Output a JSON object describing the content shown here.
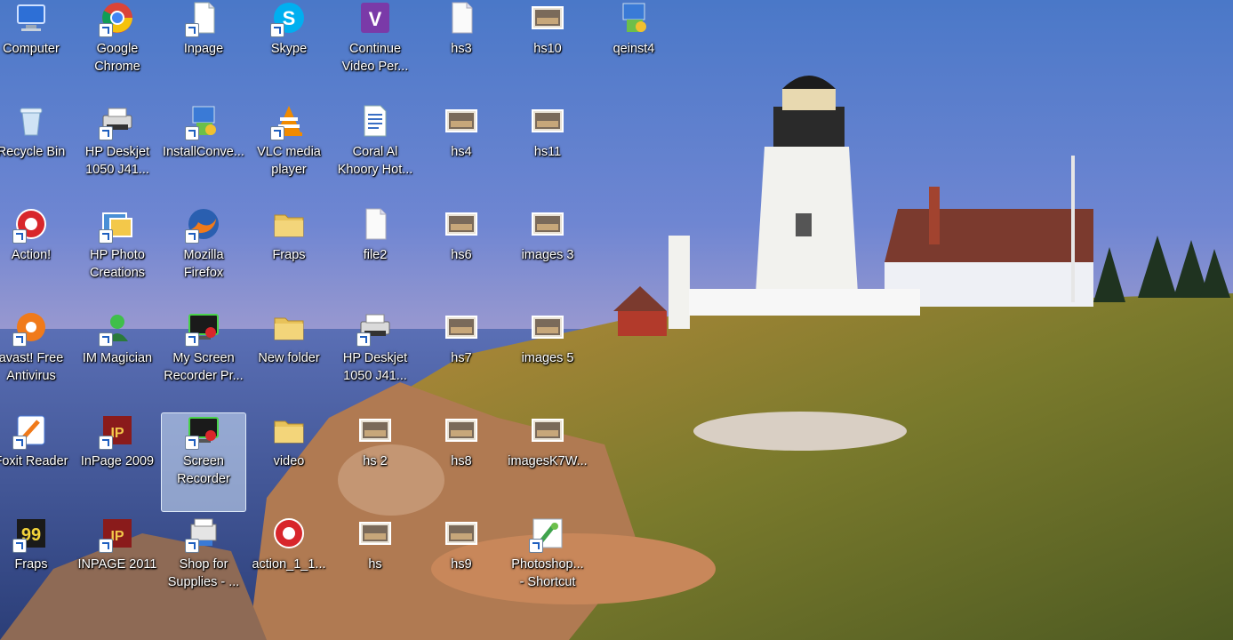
{
  "desktop": {
    "icons": [
      {
        "label": "Computer",
        "icon": "computer-icon",
        "shortcut": false,
        "selected": false
      },
      {
        "label": "Google\nChrome",
        "icon": "chrome-icon",
        "shortcut": true,
        "selected": false
      },
      {
        "label": "Inpage",
        "icon": "document-icon",
        "shortcut": true,
        "selected": false
      },
      {
        "label": "Skype",
        "icon": "skype-icon",
        "shortcut": true,
        "selected": false
      },
      {
        "label": "Continue\nVideo Per...",
        "icon": "video-editor-icon",
        "shortcut": false,
        "selected": false
      },
      {
        "label": "hs3",
        "icon": "blank-file-icon",
        "shortcut": false,
        "selected": false
      },
      {
        "label": "hs10",
        "icon": "image-thumbnail-icon",
        "shortcut": false,
        "selected": false
      },
      {
        "label": "qeinst4",
        "icon": "installer-icon",
        "shortcut": false,
        "selected": false
      },
      {
        "label": "Recycle Bin",
        "icon": "recycle-bin-icon",
        "shortcut": false,
        "selected": false
      },
      {
        "label": "HP Deskjet\n1050 J41...",
        "icon": "printer-icon",
        "shortcut": true,
        "selected": false
      },
      {
        "label": "InstallConve...",
        "icon": "installer-icon",
        "shortcut": true,
        "selected": false
      },
      {
        "label": "VLC media\nplayer",
        "icon": "vlc-icon",
        "shortcut": true,
        "selected": false
      },
      {
        "label": "Coral Al\nKhoory Hot...",
        "icon": "word-document-icon",
        "shortcut": false,
        "selected": false
      },
      {
        "label": "hs4",
        "icon": "image-thumbnail-icon",
        "shortcut": false,
        "selected": false
      },
      {
        "label": "hs11",
        "icon": "image-thumbnail-icon",
        "shortcut": false,
        "selected": false
      },
      {
        "label": "Action!",
        "icon": "action-recorder-icon",
        "shortcut": true,
        "selected": false
      },
      {
        "label": "HP Photo\nCreations",
        "icon": "photo-creations-icon",
        "shortcut": true,
        "selected": false
      },
      {
        "label": "Mozilla\nFirefox",
        "icon": "firefox-icon",
        "shortcut": true,
        "selected": false
      },
      {
        "label": "Fraps",
        "icon": "folder-icon",
        "shortcut": false,
        "selected": false
      },
      {
        "label": "file2",
        "icon": "blank-file-icon",
        "shortcut": false,
        "selected": false
      },
      {
        "label": "hs6",
        "icon": "image-thumbnail-icon",
        "shortcut": false,
        "selected": false
      },
      {
        "label": "images 3",
        "icon": "image-thumbnail-icon",
        "shortcut": false,
        "selected": false
      },
      {
        "label": "avast! Free\nAntivirus",
        "icon": "avast-icon",
        "shortcut": true,
        "selected": false
      },
      {
        "label": "IM Magician",
        "icon": "im-magician-icon",
        "shortcut": true,
        "selected": false
      },
      {
        "label": "My Screen\nRecorder Pr...",
        "icon": "screen-recorder-icon",
        "shortcut": true,
        "selected": false
      },
      {
        "label": "New folder",
        "icon": "folder-icon",
        "shortcut": false,
        "selected": false
      },
      {
        "label": "HP Deskjet\n1050 J41...",
        "icon": "printer-icon",
        "shortcut": true,
        "selected": false
      },
      {
        "label": "hs7",
        "icon": "image-thumbnail-icon",
        "shortcut": false,
        "selected": false
      },
      {
        "label": "images 5",
        "icon": "image-thumbnail-icon",
        "shortcut": false,
        "selected": false
      },
      {
        "label": "Foxit Reader",
        "icon": "foxit-reader-icon",
        "shortcut": true,
        "selected": false
      },
      {
        "label": "InPage 2009",
        "icon": "inpage-icon",
        "shortcut": true,
        "selected": false
      },
      {
        "label": "Screen\nRecorder",
        "icon": "screen-recorder-icon",
        "shortcut": true,
        "selected": true
      },
      {
        "label": "video",
        "icon": "folder-icon",
        "shortcut": false,
        "selected": false
      },
      {
        "label": "hs 2",
        "icon": "image-thumbnail-icon",
        "shortcut": false,
        "selected": false
      },
      {
        "label": "hs8",
        "icon": "image-thumbnail-icon",
        "shortcut": false,
        "selected": false
      },
      {
        "label": "imagesK7W...",
        "icon": "image-thumbnail-icon",
        "shortcut": false,
        "selected": false
      },
      {
        "label": "Fraps",
        "icon": "fraps-icon",
        "shortcut": true,
        "selected": false
      },
      {
        "label": "INPAGE 2011",
        "icon": "inpage-icon",
        "shortcut": true,
        "selected": false
      },
      {
        "label": "Shop for\nSupplies - ...",
        "icon": "shop-supplies-icon",
        "shortcut": true,
        "selected": false
      },
      {
        "label": "action_1_1...",
        "icon": "action-recorder-icon",
        "shortcut": false,
        "selected": false
      },
      {
        "label": "hs",
        "icon": "image-thumbnail-icon",
        "shortcut": false,
        "selected": false
      },
      {
        "label": "hs9",
        "icon": "image-thumbnail-icon",
        "shortcut": false,
        "selected": false
      },
      {
        "label": "Photoshop...\n- Shortcut",
        "icon": "photoshop-icon",
        "shortcut": true,
        "selected": false
      }
    ]
  }
}
